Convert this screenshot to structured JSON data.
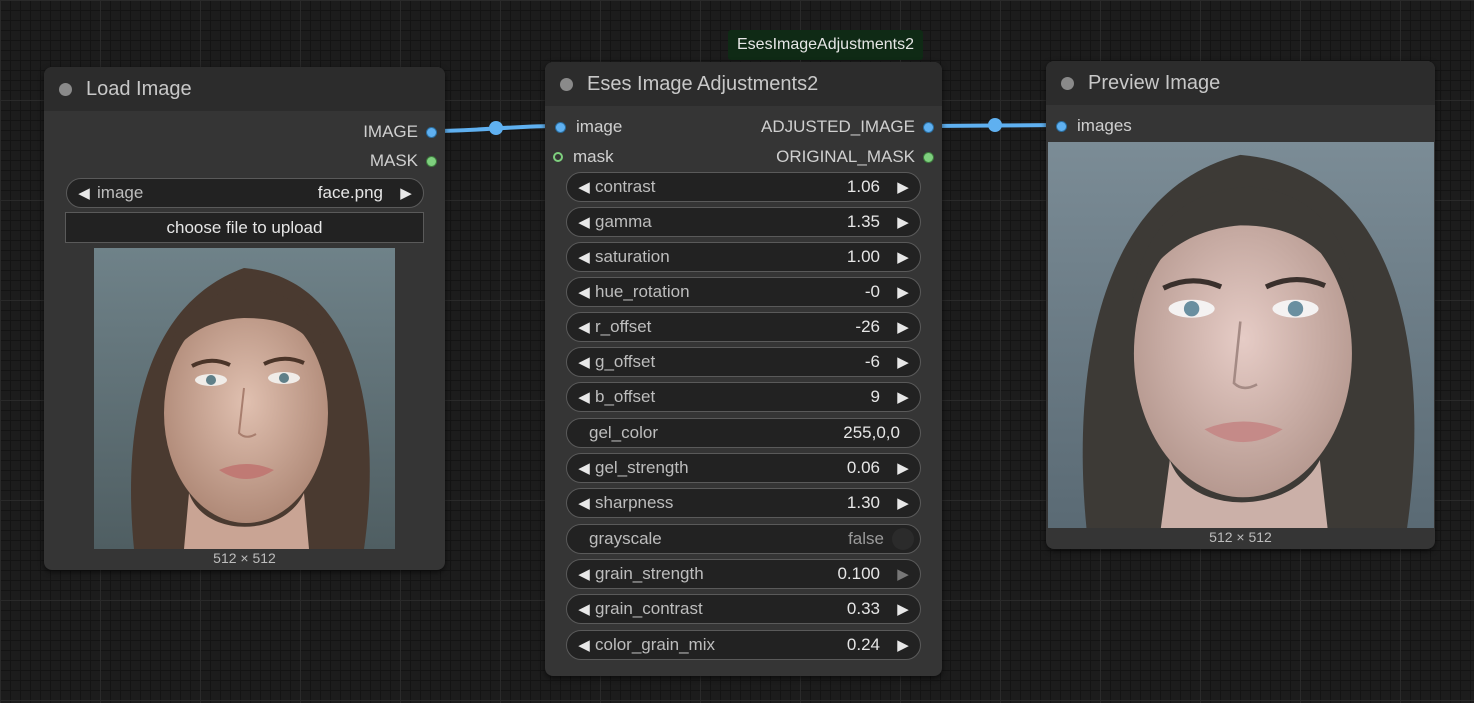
{
  "nodes": {
    "load_image": {
      "title": "Load Image",
      "outputs": [
        "IMAGE",
        "MASK"
      ],
      "image_widget": {
        "label": "image",
        "value": "face.png"
      },
      "upload_label": "choose file to upload",
      "preview_size": "512 × 512"
    },
    "adjustments": {
      "badge": "EsesImageAdjustments2",
      "title": "Eses Image Adjustments2",
      "inputs": [
        "image",
        "mask"
      ],
      "outputs": [
        "ADJUSTED_IMAGE",
        "ORIGINAL_MASK"
      ],
      "widgets": [
        {
          "label": "contrast",
          "value": "1.06"
        },
        {
          "label": "gamma",
          "value": "1.35"
        },
        {
          "label": "saturation",
          "value": "1.00"
        },
        {
          "label": "hue_rotation",
          "value": "-0"
        },
        {
          "label": "r_offset",
          "value": "-26"
        },
        {
          "label": "g_offset",
          "value": "-6"
        },
        {
          "label": "b_offset",
          "value": "9"
        },
        {
          "label": "gel_color",
          "value": "255,0,0"
        },
        {
          "label": "gel_strength",
          "value": "0.06"
        },
        {
          "label": "sharpness",
          "value": "1.30"
        },
        {
          "label": "grayscale",
          "value": "false"
        },
        {
          "label": "grain_strength",
          "value": "0.100"
        },
        {
          "label": "grain_contrast",
          "value": "0.33"
        },
        {
          "label": "color_grain_mix",
          "value": "0.24"
        }
      ]
    },
    "preview": {
      "title": "Preview Image",
      "inputs": [
        "images"
      ],
      "preview_size": "512 × 512"
    }
  },
  "colors": {
    "image_link": "#5fb0f0",
    "mask_slot": "#7ecf7e",
    "canvas_bg": "#1c1c1c",
    "node_bg": "#353535"
  }
}
